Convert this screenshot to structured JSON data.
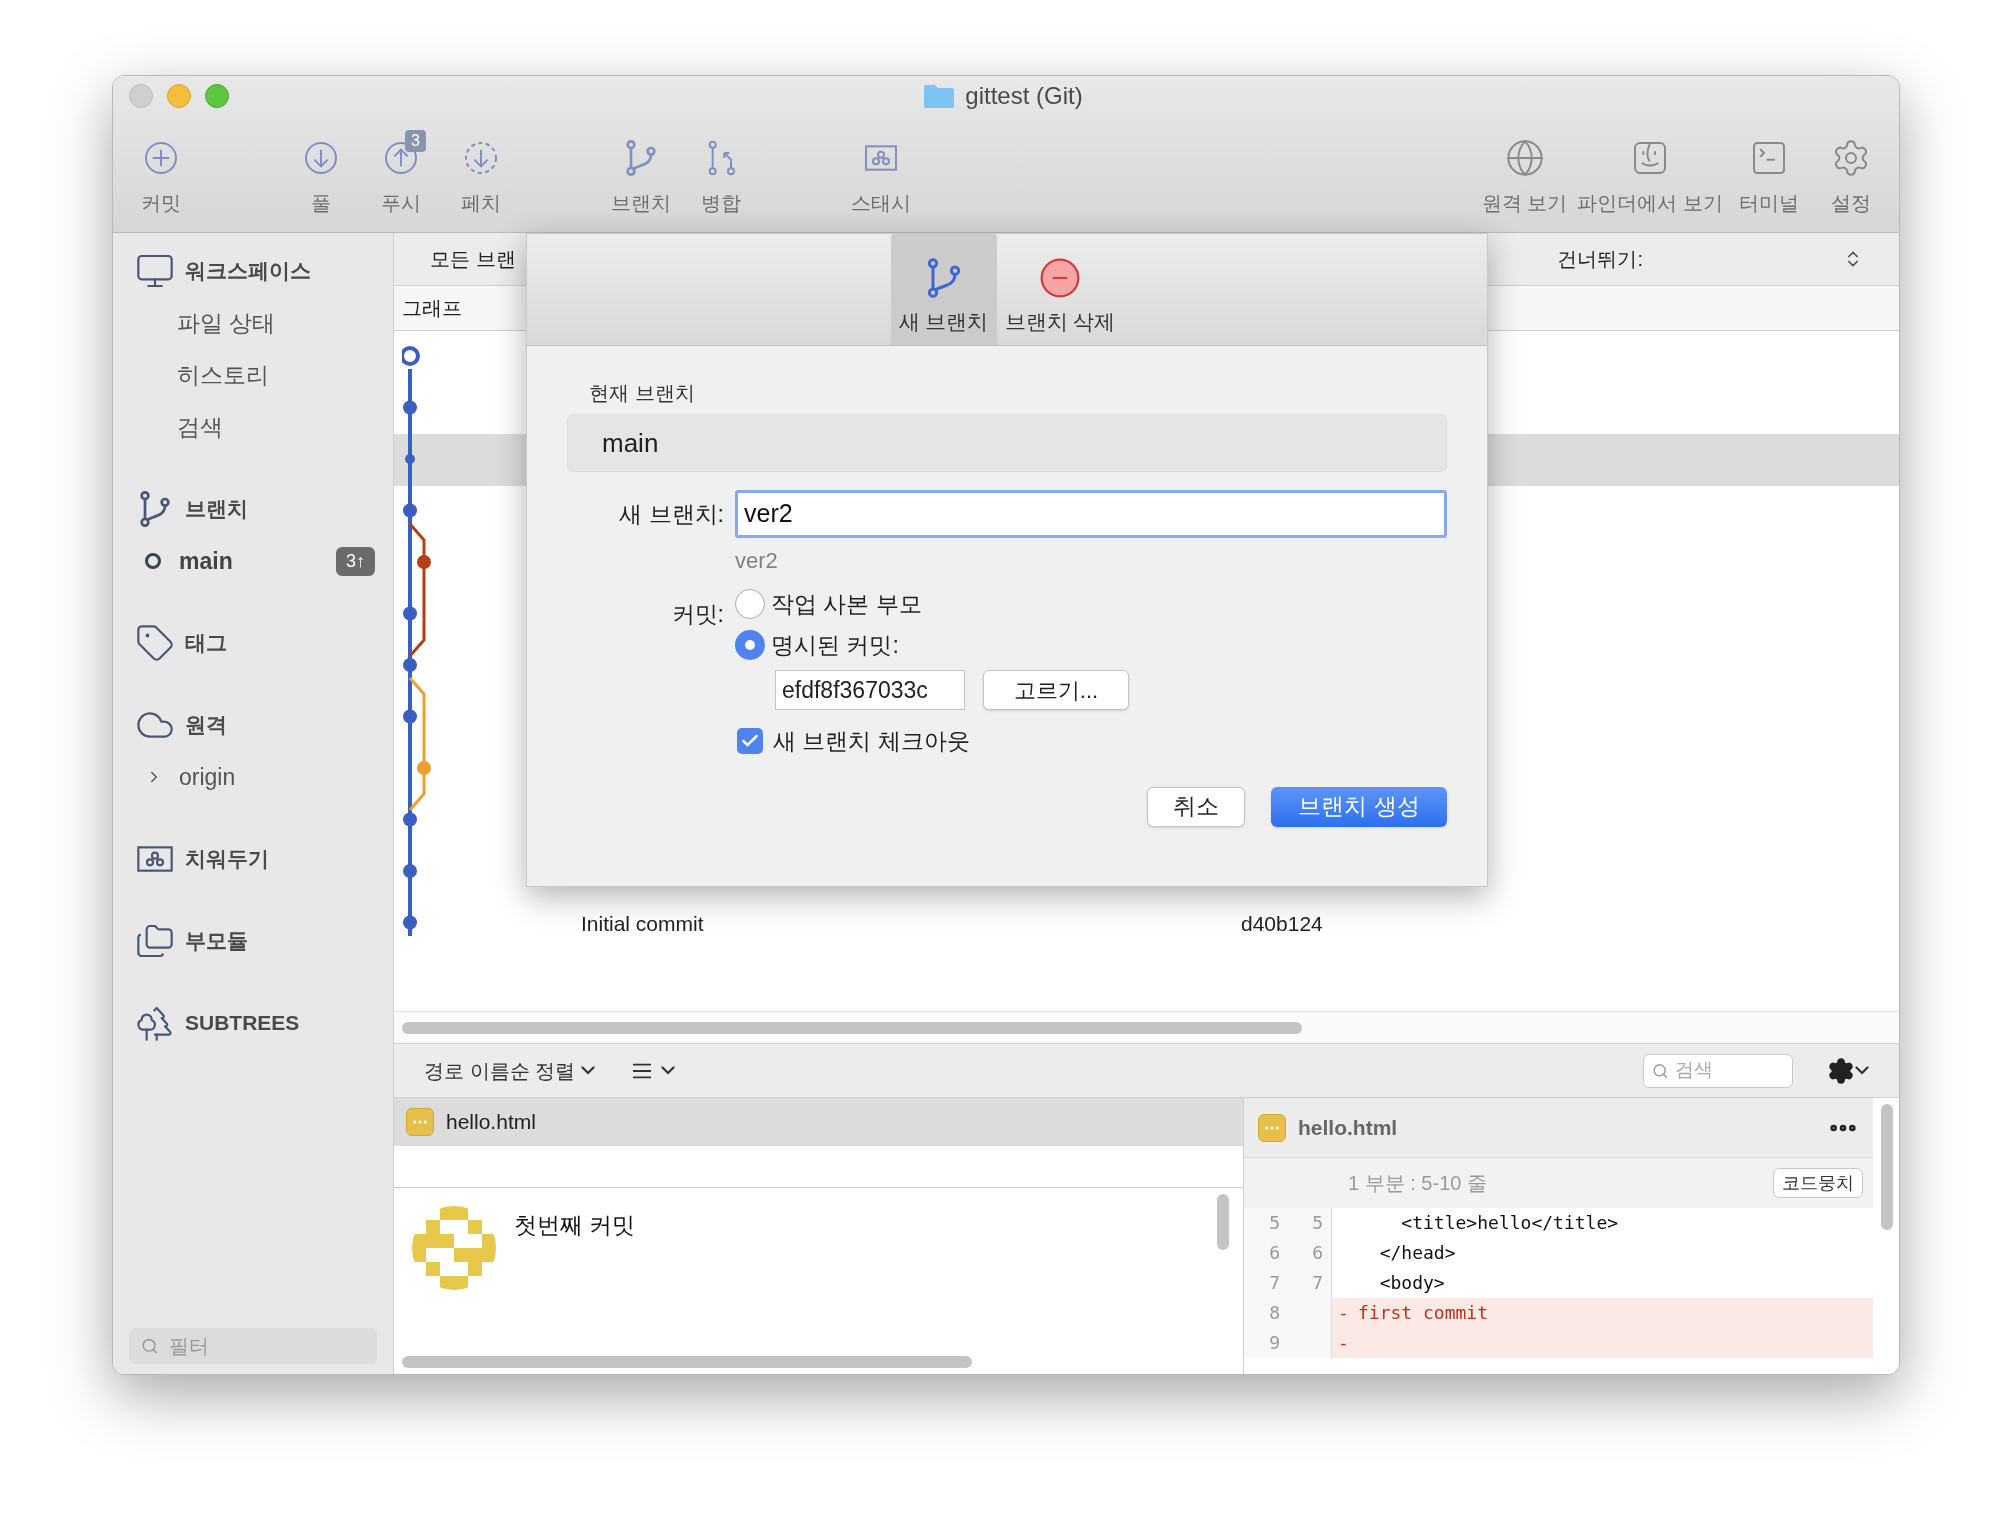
{
  "window": {
    "title": "gittest (Git)"
  },
  "toolbar": {
    "left": [
      [
        {
          "label": "커밋",
          "kind": "plus"
        }
      ],
      [
        {
          "label": "풀",
          "kind": "pull"
        },
        {
          "label": "푸시",
          "kind": "push",
          "badge": "3"
        },
        {
          "label": "페치",
          "kind": "fetch"
        }
      ],
      [
        {
          "label": "브랜치",
          "kind": "branch"
        },
        {
          "label": "병합",
          "kind": "merge"
        }
      ],
      [
        {
          "label": "스태시",
          "kind": "stash"
        }
      ]
    ],
    "right": [
      {
        "label": "원격 보기",
        "kind": "globe"
      },
      {
        "label": "파인더에서 보기",
        "kind": "finder"
      },
      {
        "label": "터미널",
        "kind": "terminal"
      },
      {
        "label": "설정",
        "kind": "gear"
      }
    ]
  },
  "sidebar": {
    "sections": [
      {
        "label": "워크스페이스",
        "kind": "monitor",
        "children": [
          {
            "label": "파일 상태"
          },
          {
            "label": "히스토리"
          },
          {
            "label": "검색"
          }
        ]
      },
      {
        "label": "브랜치",
        "kind": "branch",
        "children": [
          {
            "label": "main",
            "current": true,
            "badge": "3↑"
          }
        ]
      },
      {
        "label": "태그",
        "kind": "tag"
      },
      {
        "label": "원격",
        "kind": "cloud",
        "children": [
          {
            "label": "origin",
            "expanded": false
          }
        ]
      },
      {
        "label": "치워두기",
        "kind": "stash"
      },
      {
        "label": "부모듈",
        "kind": "folders"
      },
      {
        "label": "SUBTREES",
        "kind": "trees"
      }
    ],
    "filter": {
      "placeholder": "필터"
    }
  },
  "history": {
    "branch_filter": "모든 브랜",
    "jump_label": "건너뛰기:",
    "columns": [
      "그래프"
    ],
    "rows": [
      {
        "message": "Initial commit",
        "hash": "d40b124"
      }
    ]
  },
  "dialog": {
    "tabs": [
      {
        "label": "새 브랜치",
        "kind": "branch",
        "selected": true
      },
      {
        "label": "브랜치 삭제",
        "kind": "delete",
        "selected": false
      }
    ],
    "current_branch_label": "현재 브랜치",
    "current_branch": "main",
    "new_branch_label": "새 브랜치:",
    "new_branch_value": "ver2",
    "new_branch_preview": "ver2",
    "commit_label": "커밋:",
    "commit_options": [
      {
        "label": "작업 사본 부모",
        "selected": false
      },
      {
        "label": "명시된 커밋:",
        "selected": true
      }
    ],
    "commit_hash": "efdf8f367033c",
    "choose_button": "고르기...",
    "checkout": {
      "label": "새 브랜치 체크아웃",
      "checked": true
    },
    "cancel_button": "취소",
    "create_button": "브랜치 생성"
  },
  "files": {
    "sort_label": "경로 이름순 정렬",
    "search": {
      "placeholder": "검색"
    },
    "items": [
      {
        "name": "hello.html",
        "selected": true
      }
    ],
    "commit_message": "첫번째 커밋"
  },
  "diff": {
    "file": "hello.html",
    "hunk_title": "1 부분 : 5-10 줄",
    "hunk_button": "코드뭉치",
    "lines": [
      {
        "kind": "context",
        "old": "5",
        "new": "5",
        "text": "    <title>hello</title>"
      },
      {
        "kind": "context",
        "old": "6",
        "new": "6",
        "text": "  </head>"
      },
      {
        "kind": "context",
        "old": "7",
        "new": "7",
        "text": "  <body>"
      },
      {
        "kind": "removed",
        "old": "8",
        "sign": "-",
        "text": "first commit"
      },
      {
        "kind": "removed",
        "old": "9",
        "sign": "-"
      }
    ]
  }
}
